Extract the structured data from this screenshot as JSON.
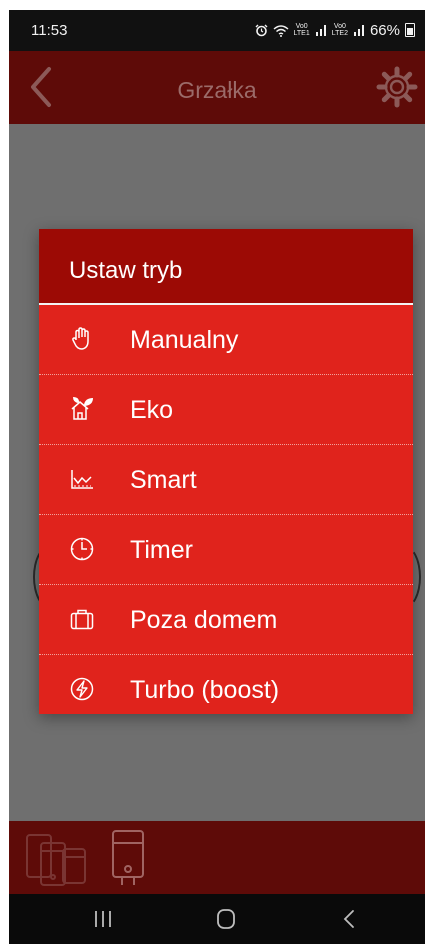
{
  "status_bar": {
    "time": "11:53",
    "battery": "66%",
    "sim1": "VoLTE1",
    "sim2": "VoLTE2"
  },
  "app_bar": {
    "title": "Grzałka",
    "back_icon": "chevron-left-icon",
    "settings_icon": "gear-icon"
  },
  "dialog": {
    "title": "Ustaw tryb",
    "options": [
      {
        "label": "Manualny",
        "icon": "hand-icon"
      },
      {
        "label": "Eko",
        "icon": "eco-house-icon"
      },
      {
        "label": "Smart",
        "icon": "chart-icon"
      },
      {
        "label": "Timer",
        "icon": "clock-icon"
      },
      {
        "label": "Poza domem",
        "icon": "suitcase-icon"
      },
      {
        "label": "Turbo (boost)",
        "icon": "lightning-icon"
      }
    ]
  },
  "colors": {
    "app_bar": "#5e0b08",
    "dialog_header": "#9c0a05",
    "dialog_body": "#e0231c",
    "scrim": "#6f6f6f"
  }
}
